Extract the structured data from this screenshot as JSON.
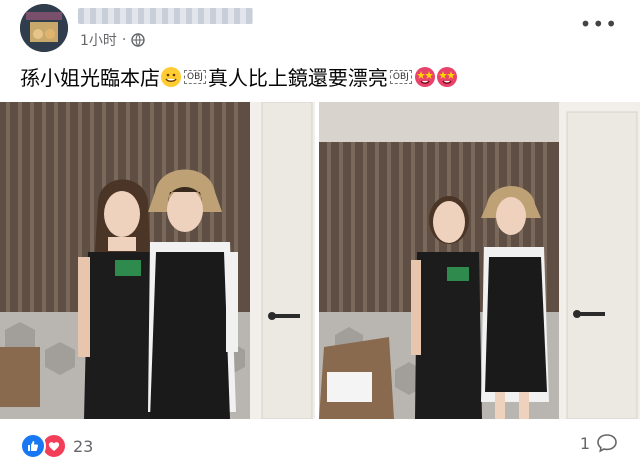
{
  "post": {
    "time": "1小时",
    "privacy_icon": "globe-icon",
    "caption_text_1": "孫小姐光臨本店",
    "caption_obj_1": "OBJ",
    "caption_text_2": "真人比上鏡還要漂亮",
    "caption_obj_2": "OBJ",
    "more_label": "•••"
  },
  "footer": {
    "reaction_count": "23",
    "comment_count": "1"
  },
  "colors": {
    "like": "#1877f2",
    "love": "#f33e58",
    "text_secondary": "#65676b"
  }
}
